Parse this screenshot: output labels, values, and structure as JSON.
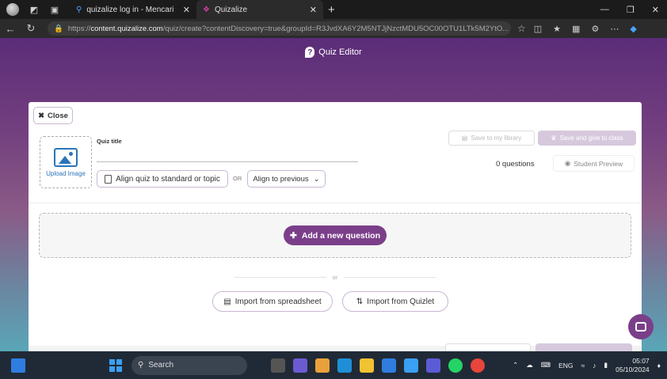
{
  "browser": {
    "tabs": [
      {
        "title": "quizalize log in - Mencari",
        "active": false
      },
      {
        "title": "Quizalize",
        "active": true
      }
    ],
    "url_prefix": "https://",
    "url_host": "content.quizalize.com",
    "url_path": "/quiz/create?contentDiscovery=true&groupId=R3JvdXA6Y2M5NTJjNzctMDU5OC00OTU1LTk5M2YtO..."
  },
  "editor": {
    "header_title": "Quiz Editor",
    "close_label": "Close",
    "upload_label": "Upload Image",
    "quiz_title_label": "Quiz title",
    "quiz_title_value": "",
    "align_btn_label": "Align quiz to standard or topic",
    "or_text": "OR",
    "align_prev_label": "Align to previous",
    "save_library_label": "Save to my library",
    "save_give_label": "Save and give to class",
    "question_count": "0 questions",
    "student_preview_label": "Student Preview",
    "add_question_label": "Add a new question",
    "or_divider": "or",
    "import_spreadsheet_label": "Import from spreadsheet",
    "import_quizlet_label": "Import from Quizlet"
  },
  "taskbar": {
    "search_label": "Search",
    "lang": "ENG",
    "time": "05:07",
    "date": "05/10/2024"
  },
  "colors": {
    "brand_purple": "#7b3f8a",
    "link_blue": "#2a74b8"
  }
}
